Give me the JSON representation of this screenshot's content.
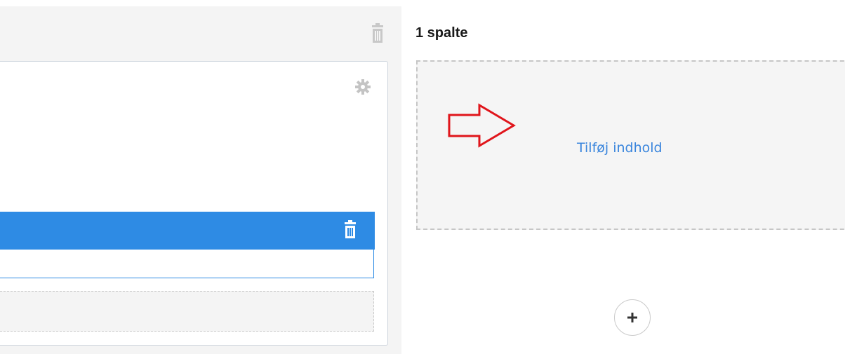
{
  "column": {
    "title": "1 spalte",
    "add_content_label": "Tilføj indhold"
  },
  "icons": {
    "left_trash": "trash-icon",
    "settings": "gear-icon",
    "row_trash": "trash-icon",
    "annotation_arrow": "arrow-right-icon",
    "add": "plus-icon"
  },
  "colors": {
    "accent": "#2e8be4",
    "link": "#3b86dd",
    "annotation": "#e0151b"
  }
}
